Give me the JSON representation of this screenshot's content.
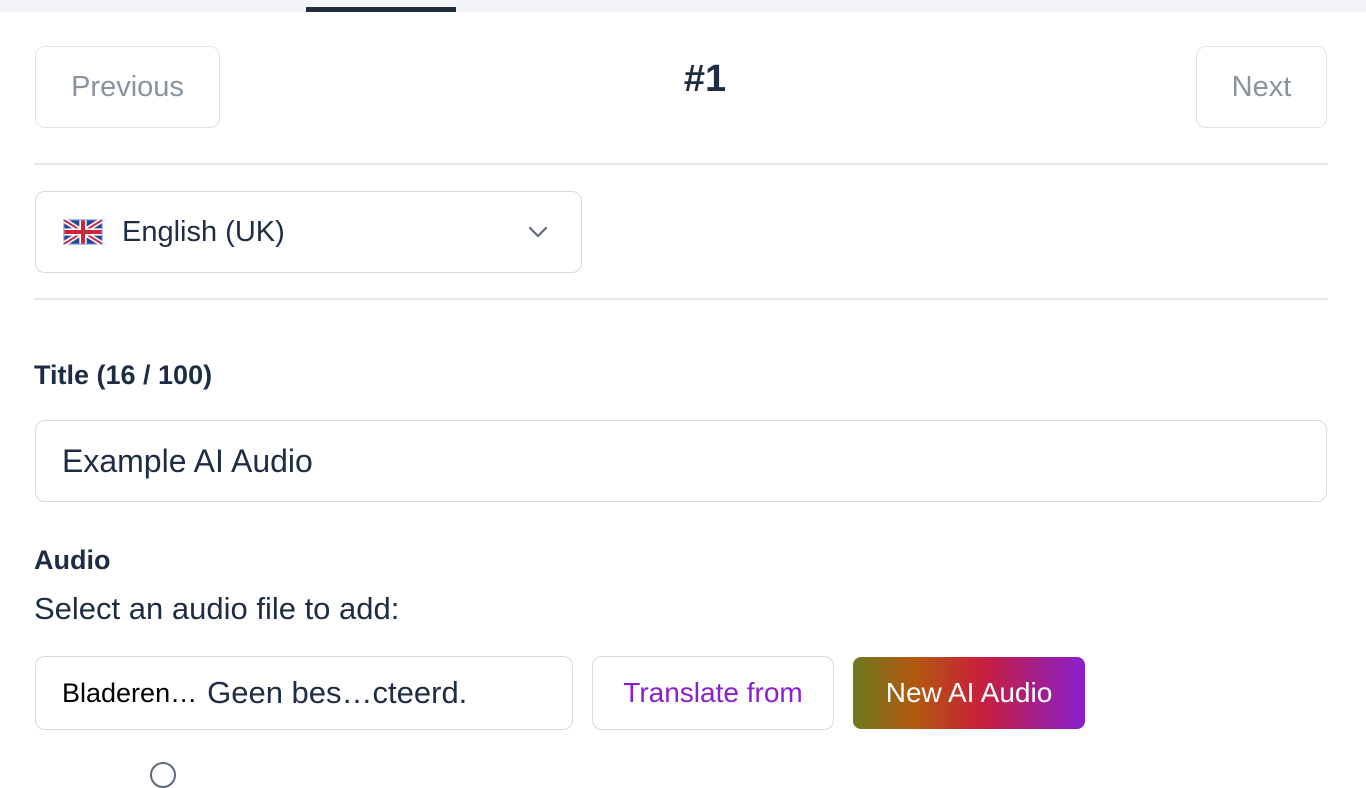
{
  "nav": {
    "previous_label": "Previous",
    "next_label": "Next",
    "record_number": "#1"
  },
  "language": {
    "selected": "English (UK)",
    "flag_icon": "uk-flag-icon"
  },
  "title_field": {
    "label": "Title (16 / 100)",
    "value": "Example AI Audio"
  },
  "audio": {
    "label": "Audio",
    "hint": "Select an audio file to add:",
    "browse_label": "Bladeren…",
    "file_status": "Geen bes…cteerd.",
    "translate_label": "Translate from",
    "new_ai_label": "New AI Audio"
  },
  "colors": {
    "text_primary": "#1e2d44",
    "accent_purple": "#8a1fd0",
    "border": "#d5dbe3"
  }
}
